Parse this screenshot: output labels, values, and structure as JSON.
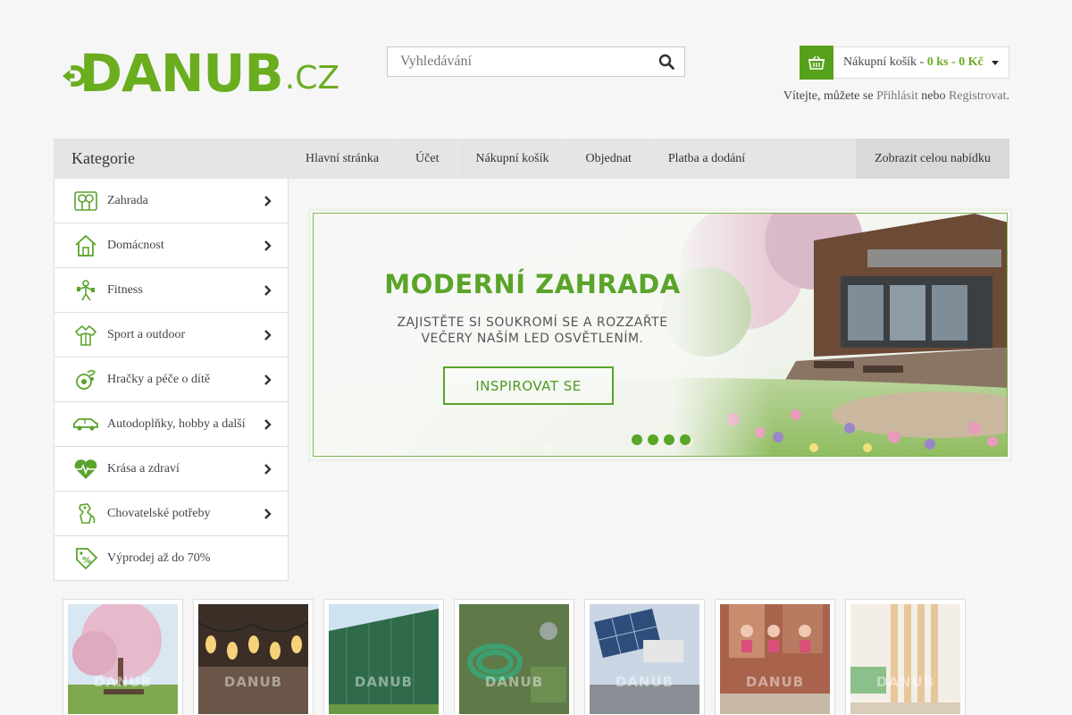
{
  "header": {
    "logo_text": "DANUB",
    "logo_tld": ".CZ",
    "search_placeholder": "Vyhledávání",
    "cart": {
      "label": "Nákupní košík - ",
      "summary": "0 ks - 0 Kč"
    },
    "welcome": {
      "prefix": "Vítejte, můžete se ",
      "login": "Přihlásit",
      "middle": " nebo ",
      "register": "Registrovat",
      "suffix": "."
    }
  },
  "nav": {
    "categories_title": "Kategorie",
    "items": [
      "Hlavní stránka",
      "Účet",
      "Nákupní košík",
      "Objednat",
      "Platba a dodání"
    ],
    "show_all": "Zobrazit celou nabídku"
  },
  "sidebar": {
    "items": [
      {
        "label": "Zahrada",
        "icon": "garden-icon",
        "has_arrow": true
      },
      {
        "label": "Domácnost",
        "icon": "house-icon",
        "has_arrow": true
      },
      {
        "label": "Fitness",
        "icon": "fitness-icon",
        "has_arrow": true
      },
      {
        "label": "Sport a outdoor",
        "icon": "outdoor-icon",
        "has_arrow": true
      },
      {
        "label": "Hračky a péče o dítě",
        "icon": "baby-icon",
        "has_arrow": true
      },
      {
        "label": "Autodoplňky, hobby a další",
        "icon": "car-icon",
        "has_arrow": true
      },
      {
        "label": "Krása a zdraví",
        "icon": "heart-pulse-icon",
        "has_arrow": true
      },
      {
        "label": "Chovatelské potřeby",
        "icon": "pet-icon",
        "has_arrow": true
      },
      {
        "label": "Výprodej až do 70%",
        "icon": "sale-tag-icon",
        "has_arrow": false
      }
    ]
  },
  "banner": {
    "title": "MODERNÍ ZAHRADA",
    "subtitle_line1": "ZAJISTĚTE SI SOUKROMÍ SE A ROZZAŘTE",
    "subtitle_line2": "VEČERY NAŠÍM LED OSVĚTLENÍM.",
    "button": "INSPIROVAT SE",
    "slide_count": 4,
    "active_slide": 1
  },
  "products": {
    "watermark": "DANUB",
    "items": [
      {
        "name": "blossom-tree-thumbnail"
      },
      {
        "name": "string-lights-thumbnail"
      },
      {
        "name": "green-fence-thumbnail"
      },
      {
        "name": "garden-hose-thumbnail"
      },
      {
        "name": "solar-lamp-thumbnail"
      },
      {
        "name": "fitness-women-thumbnail"
      },
      {
        "name": "room-divider-thumbnail"
      }
    ]
  },
  "colors": {
    "brand_green": "#6aad1f",
    "button_green": "#55a21a",
    "nav_bg": "#e5e5e5"
  }
}
